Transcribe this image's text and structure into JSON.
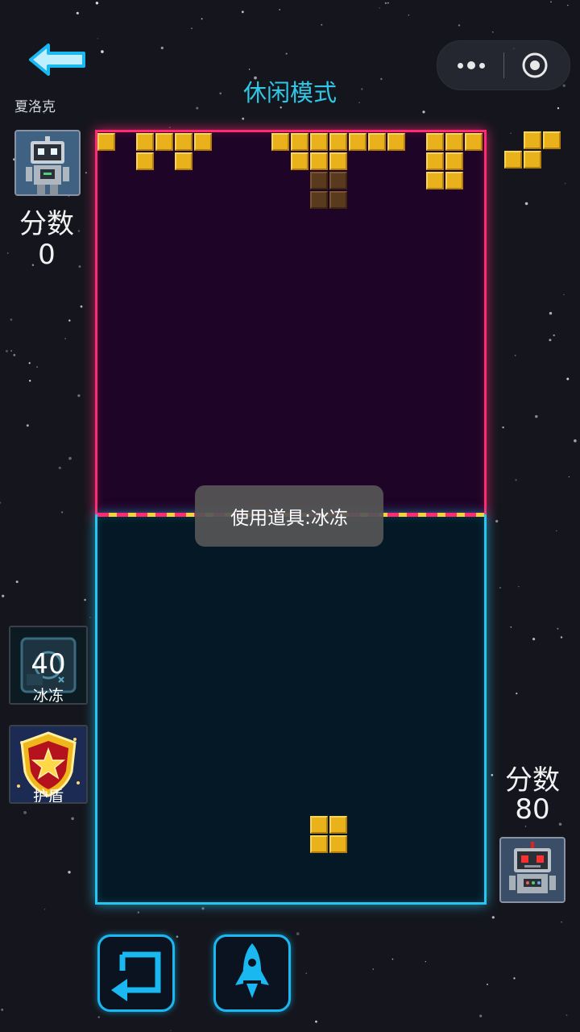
{
  "header": {
    "title": "休闲模式",
    "back_icon": "arrow-left-icon",
    "more_icon": "more-dots-icon",
    "close_icon": "target-close-icon"
  },
  "player": {
    "name": "夏洛克",
    "score_label": "分数",
    "score": "0",
    "avatar_icon": "robot-avatar-icon"
  },
  "opponent": {
    "score_label": "分数",
    "score": "80",
    "avatar_icon": "red-eyed-robot-avatar-icon"
  },
  "toast": {
    "message": "使用道具:冰冻"
  },
  "items": {
    "freeze": {
      "count": "40",
      "label": "冰冻",
      "icon": "ice-safe-icon"
    },
    "shield": {
      "label": "护盾",
      "icon": "star-shield-icon"
    }
  },
  "controls": {
    "rotate_icon": "rotate-icon",
    "rocket_icon": "rocket-icon"
  },
  "colors": {
    "background": "#15161d",
    "title": "#2ec8e6",
    "top_board_border": "#ff2a74",
    "bottom_board_border": "#25c6f2",
    "block": "#e9b21a",
    "dark_block": "#5a3a1c"
  }
}
